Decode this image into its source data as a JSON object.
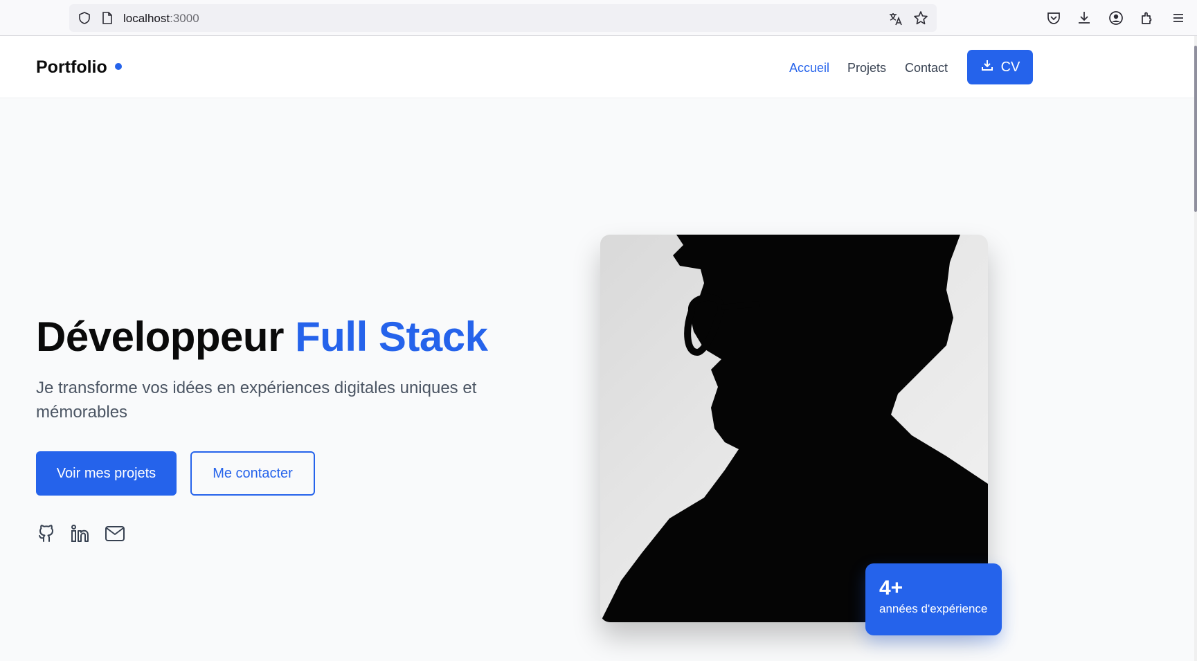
{
  "browser": {
    "url_host": "localhost",
    "url_port": ":3000"
  },
  "header": {
    "brand": "Portfolio",
    "nav": [
      {
        "label": "Accueil",
        "active": true
      },
      {
        "label": "Projets",
        "active": false
      },
      {
        "label": "Contact",
        "active": false
      }
    ],
    "cv_label": "CV"
  },
  "hero": {
    "title_plain": "Développeur ",
    "title_accent": "Full Stack",
    "subtitle": "Je transforme vos idées en expériences digitales uniques et mémorables",
    "primary_cta": "Voir mes projets",
    "secondary_cta": "Me contacter",
    "social_icons": [
      "github-icon",
      "linkedin-icon",
      "mail-icon"
    ]
  },
  "experience": {
    "value": "4+",
    "label": "années d'expérience"
  },
  "colors": {
    "accent": "#2563eb",
    "background": "#f9fafb"
  }
}
